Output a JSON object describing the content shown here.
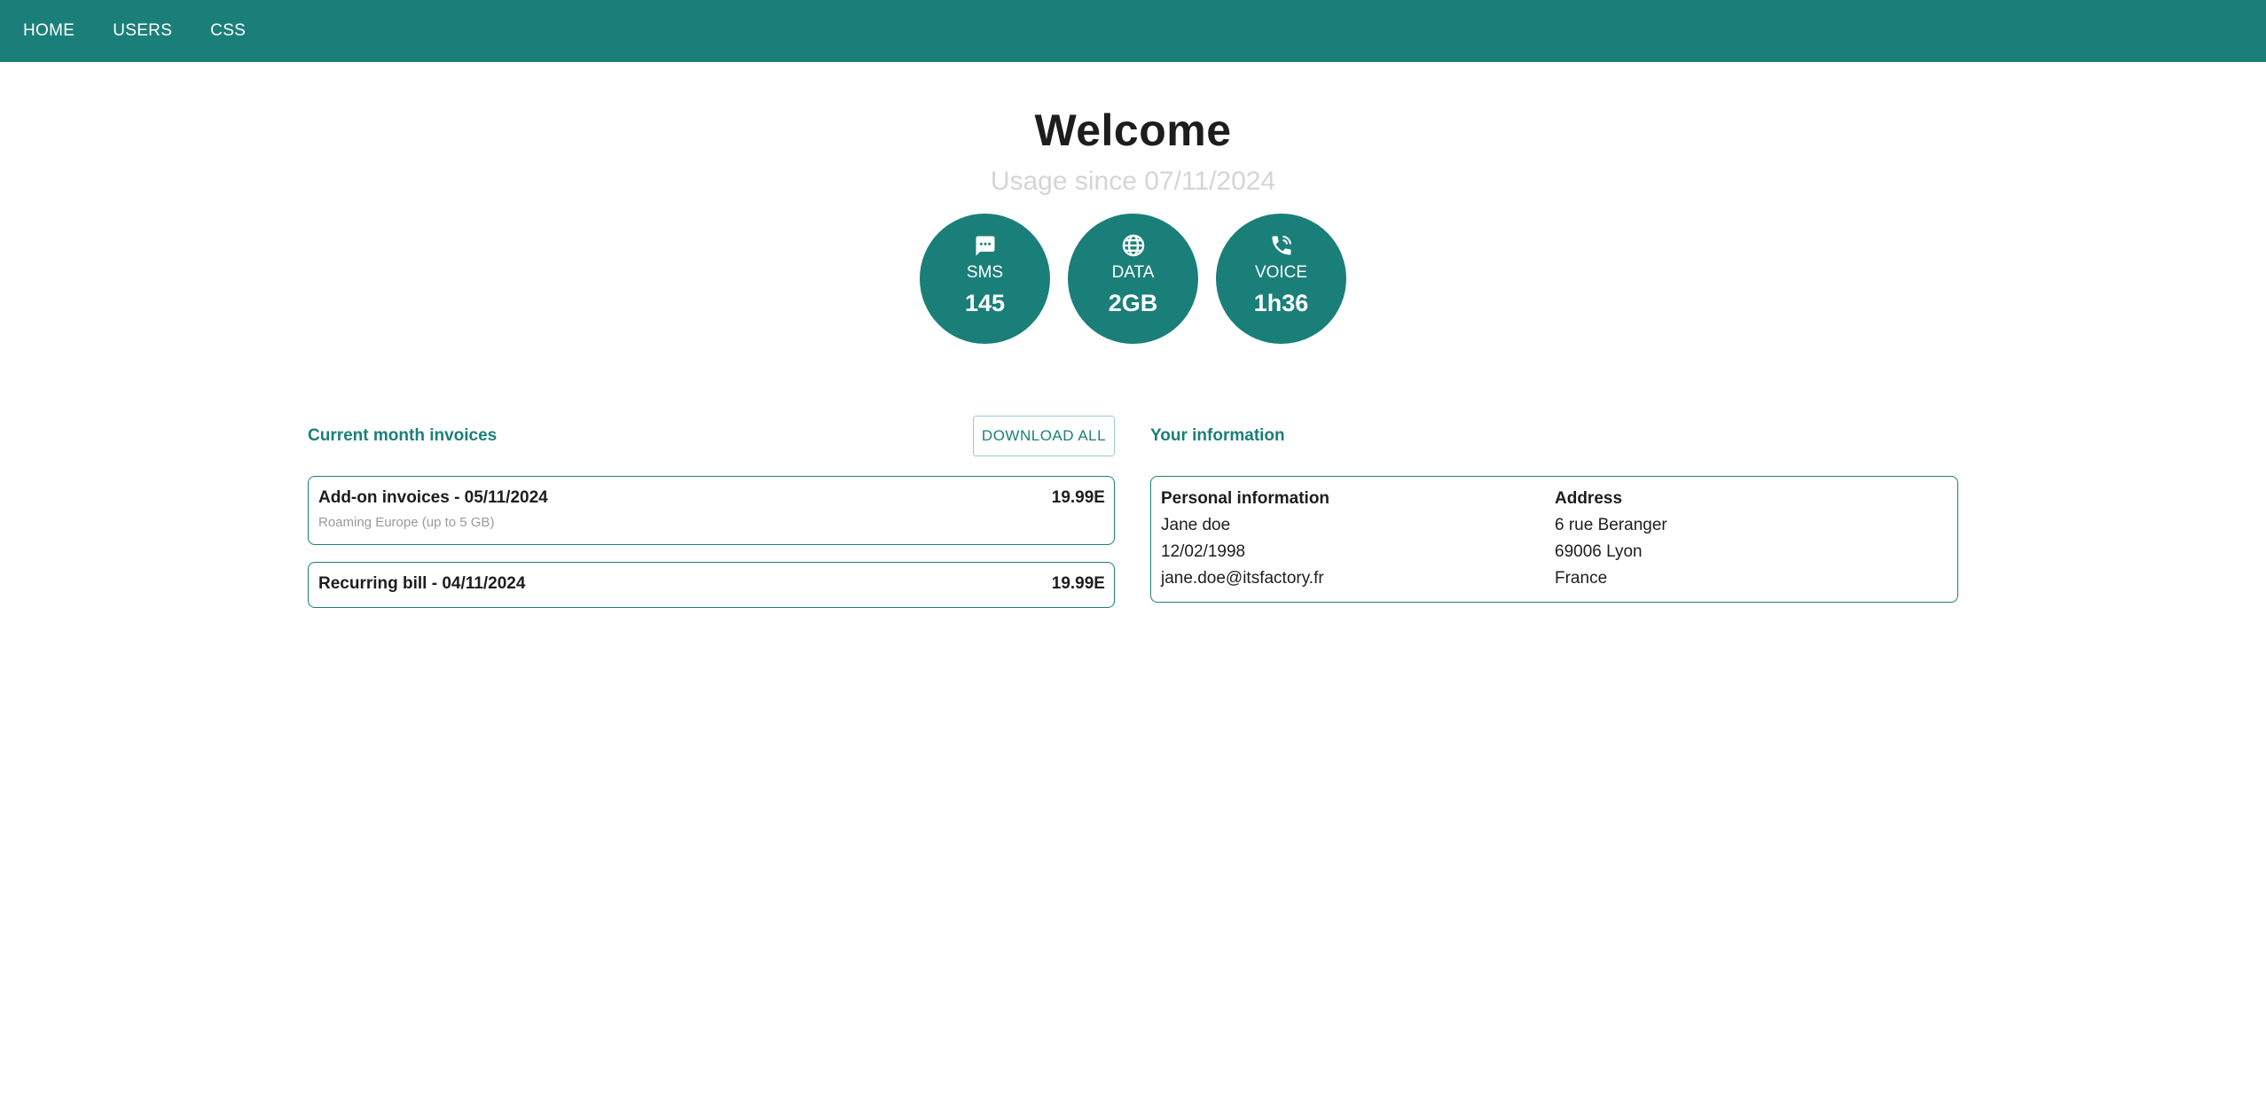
{
  "nav": {
    "items": [
      {
        "label": "HOME"
      },
      {
        "label": "USERS"
      },
      {
        "label": "CSS"
      }
    ]
  },
  "header": {
    "title": "Welcome",
    "subtitle": "Usage since 07/11/2024"
  },
  "usage": [
    {
      "icon": "message-icon",
      "label": "SMS",
      "value": "145"
    },
    {
      "icon": "globe-icon",
      "label": "DATA",
      "value": "2GB"
    },
    {
      "icon": "phone-icon",
      "label": "VOICE",
      "value": "1h36"
    }
  ],
  "invoices": {
    "section_title": "Current month invoices",
    "download_label": "DOWNLOAD ALL",
    "items": [
      {
        "title": "Add-on invoices - 05/11/2024",
        "amount": "19.99E",
        "detail": "Roaming Europe (up to 5 GB)"
      },
      {
        "title": "Recurring bill - 04/11/2024",
        "amount": "19.99E"
      }
    ]
  },
  "info": {
    "section_title": "Your information",
    "personal": {
      "heading": "Personal information",
      "name": "Jane doe",
      "birthdate": "12/02/1998",
      "email": "jane.doe@itsfactory.fr"
    },
    "address": {
      "heading": "Address",
      "street": "6 rue Beranger",
      "city": "69006 Lyon",
      "country": "France"
    }
  },
  "colors": {
    "primary": "#1b7f79",
    "subtitle": "#d5d5d5",
    "muted_text": "#9a9a9a"
  }
}
